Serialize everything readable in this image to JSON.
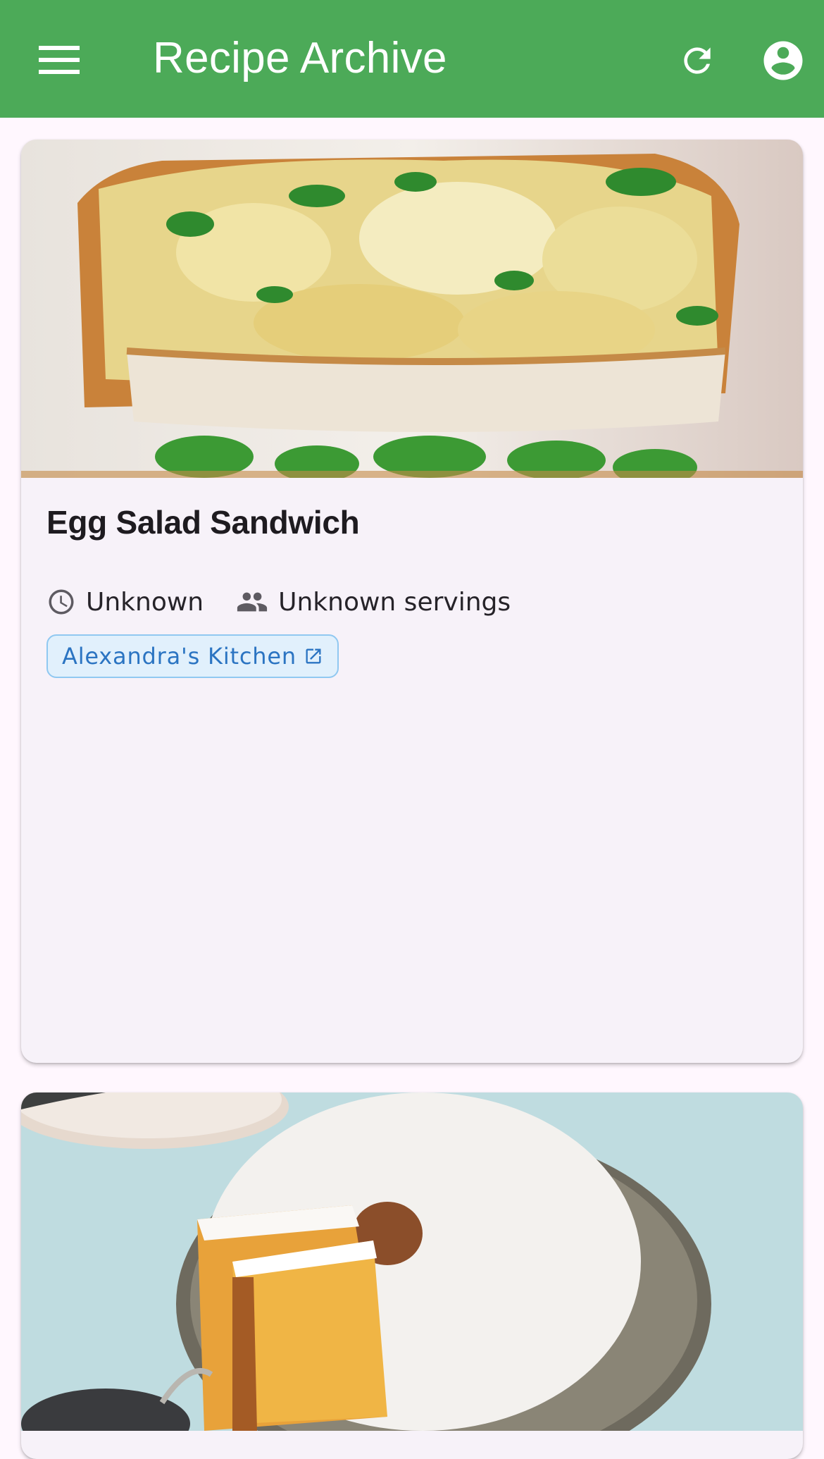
{
  "app_bar": {
    "title": "Recipe Archive",
    "background_color": "#4CAA58",
    "icons": [
      "menu-icon",
      "refresh-icon",
      "account-circle-icon"
    ]
  },
  "recipes": [
    {
      "title": "Egg Salad Sandwich",
      "image": "egg salad sandwich photo",
      "time": "Unknown",
      "servings": "Unknown servings",
      "source_label": "Alexandra's Kitchen",
      "source_icon": "open-in-new-icon",
      "time_icon": "clock-icon",
      "servings_icon": "people-icon"
    },
    {
      "image": "powdered sugar bundt cake photo"
    }
  ],
  "colors": {
    "page_background": "#FFF7FE",
    "card_background": "#F7F2F9",
    "chip_background": "#E1F0FC",
    "chip_border": "#90C8F1",
    "chip_text": "#2B74C2"
  }
}
